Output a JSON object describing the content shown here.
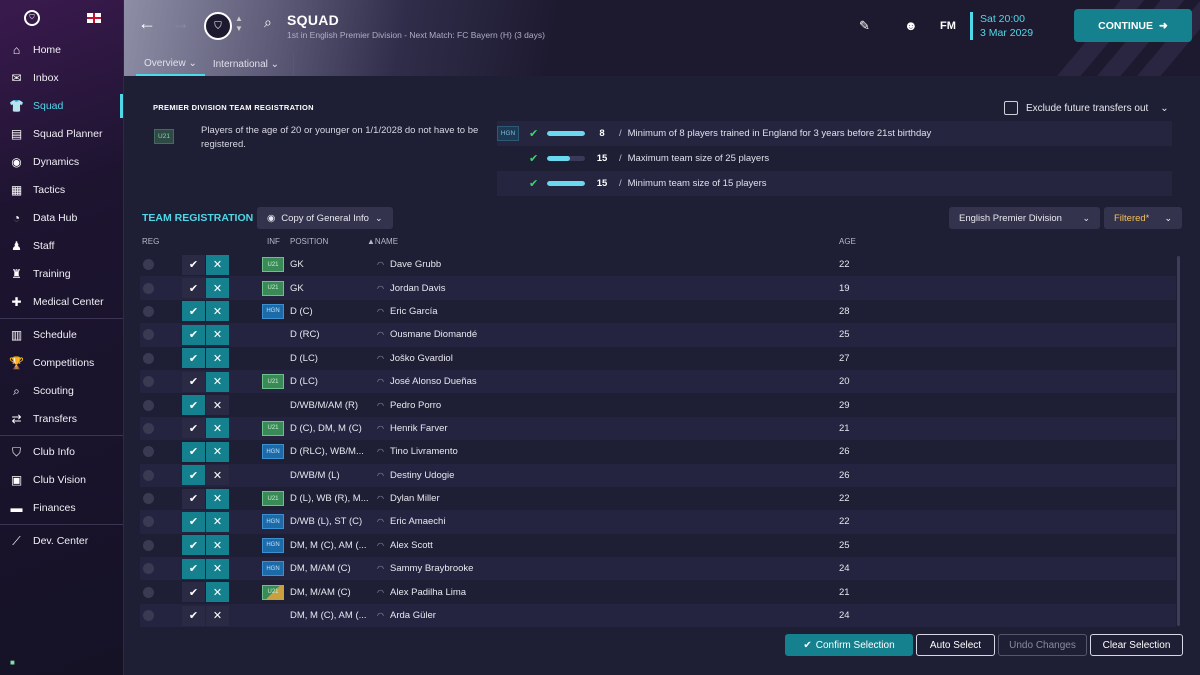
{
  "sidebar": {
    "items": [
      {
        "label": "Home",
        "icon": "home-icon",
        "glyph": "⌂"
      },
      {
        "label": "Inbox",
        "icon": "inbox-icon",
        "glyph": "✉"
      },
      {
        "label": "Squad",
        "icon": "shirt-icon",
        "glyph": "👕",
        "active": true
      },
      {
        "label": "Squad Planner",
        "icon": "clipboard-icon",
        "glyph": "▤"
      },
      {
        "label": "Dynamics",
        "icon": "dynamics-icon",
        "glyph": "◉"
      },
      {
        "label": "Tactics",
        "icon": "tactics-icon",
        "glyph": "▦"
      },
      {
        "label": "Data Hub",
        "icon": "datahub-icon",
        "glyph": "◔"
      },
      {
        "label": "Staff",
        "icon": "staff-icon",
        "glyph": "♟"
      },
      {
        "label": "Training",
        "icon": "training-icon",
        "glyph": "♜"
      },
      {
        "label": "Medical Center",
        "icon": "medical-icon",
        "glyph": "✚"
      },
      {
        "label": "Schedule",
        "icon": "calendar-icon",
        "glyph": "▥"
      },
      {
        "label": "Competitions",
        "icon": "trophy-icon",
        "glyph": "🏆"
      },
      {
        "label": "Scouting",
        "icon": "search-icon",
        "glyph": "⌕"
      },
      {
        "label": "Transfers",
        "icon": "transfers-icon",
        "glyph": "⇄"
      },
      {
        "label": "Club Info",
        "icon": "shield-icon",
        "glyph": "⛉"
      },
      {
        "label": "Club Vision",
        "icon": "vision-icon",
        "glyph": "▣"
      },
      {
        "label": "Finances",
        "icon": "finances-icon",
        "glyph": "▬"
      },
      {
        "label": "Dev. Center",
        "icon": "devcenter-icon",
        "glyph": "⟋"
      }
    ]
  },
  "header": {
    "title": "SQUAD",
    "subtitle": "1st in English Premier Division - Next Match: FC Bayern (H) (3 days)",
    "tabs": [
      {
        "label": "Overview ⌄"
      },
      {
        "label": "International ⌄"
      }
    ],
    "date_time": "Sat 20:00",
    "date": "3 Mar 2029",
    "fm_logo": "FM",
    "continue_label": "CONTINUE"
  },
  "registration": {
    "title": "PREMIER DIVISION TEAM REGISTRATION",
    "u21_badge": "U21",
    "u21_text": "Players of the age of 20 or younger on 1/1/2028 do not have to be registered.",
    "exclude_label": "Exclude future transfers out",
    "hgn_badge": "HGN",
    "rules": [
      {
        "value": "8",
        "text": "Minimum of 8 players trained in England for 3 years before 21st birthday",
        "progress": 1.0
      },
      {
        "value": "15",
        "text": "Maximum team size of 25 players",
        "progress": 0.6
      },
      {
        "value": "15",
        "text": "Minimum team size of 15 players",
        "progress": 1.0
      }
    ]
  },
  "team_registration": {
    "title": "TEAM REGISTRATION",
    "view_label": "Copy of General Info",
    "division_label": "English Premier Division",
    "filter_label": "Filtered*",
    "columns": {
      "reg": "REG",
      "inf": "INF",
      "position": "POSITION",
      "name": "▲NAME",
      "age": "AGE"
    },
    "players": [
      {
        "tag": "U21",
        "tagType": "u21",
        "position": "GK",
        "name": "Dave Grubb",
        "age": "22",
        "registered": true
      },
      {
        "tag": "U21",
        "tagType": "u21",
        "position": "GK",
        "name": "Jordan Davis",
        "age": "19",
        "registered": true
      },
      {
        "tag": "HGN",
        "tagType": "hgn",
        "position": "D (C)",
        "name": "Eric García",
        "age": "28",
        "registered": true
      },
      {
        "tag": "",
        "tagType": "",
        "position": "D (RC)",
        "name": "Ousmane Diomandé",
        "age": "25",
        "registered": true
      },
      {
        "tag": "",
        "tagType": "",
        "position": "D (LC)",
        "name": "Joško Gvardiol",
        "age": "27",
        "registered": true
      },
      {
        "tag": "U21",
        "tagType": "u21",
        "position": "D (LC)",
        "name": "José Alonso Dueñas",
        "age": "20",
        "registered": true
      },
      {
        "tag": "",
        "tagType": "",
        "position": "D/WB/M/AM (R)",
        "name": "Pedro Porro",
        "age": "29",
        "registered": true
      },
      {
        "tag": "U21",
        "tagType": "u21",
        "position": "D (C), DM, M (C)",
        "name": "Henrik Farver",
        "age": "21",
        "registered": true
      },
      {
        "tag": "HGN",
        "tagType": "hgn",
        "position": "D (RLC), WB/M...",
        "name": "Tino Livramento",
        "age": "26",
        "registered": true
      },
      {
        "tag": "",
        "tagType": "",
        "position": "D/WB/M (L)",
        "name": "Destiny Udogie",
        "age": "26",
        "registered": true
      },
      {
        "tag": "U21",
        "tagType": "u21",
        "position": "D (L), WB (R), M...",
        "name": "Dylan Miller",
        "age": "22",
        "registered": true
      },
      {
        "tag": "HGN",
        "tagType": "hgn",
        "position": "D/WB (L), ST (C)",
        "name": "Eric Amaechi",
        "age": "22",
        "registered": true
      },
      {
        "tag": "HGN",
        "tagType": "hgn",
        "position": "DM, M (C), AM (...",
        "name": "Alex Scott",
        "age": "25",
        "registered": true
      },
      {
        "tag": "HGN",
        "tagType": "hgn",
        "position": "DM, M/AM (C)",
        "name": "Sammy Braybrooke",
        "age": "24",
        "registered": true
      },
      {
        "tag": "U21",
        "tagType": "both",
        "position": "DM, M/AM (C)",
        "name": "Alex Padilha Lima",
        "age": "21",
        "registered": true
      },
      {
        "tag": "",
        "tagType": "",
        "position": "DM, M (C), AM (...",
        "name": "Arda Güler",
        "age": "24",
        "registered": true
      }
    ]
  },
  "footer": {
    "confirm_label": "Confirm Selection",
    "auto_label": "Auto Select",
    "undo_label": "Undo Changes",
    "clear_label": "Clear Selection"
  },
  "colors": {
    "accent": "#4fd8e8",
    "button": "#16818e",
    "check": "#3ed66a"
  }
}
